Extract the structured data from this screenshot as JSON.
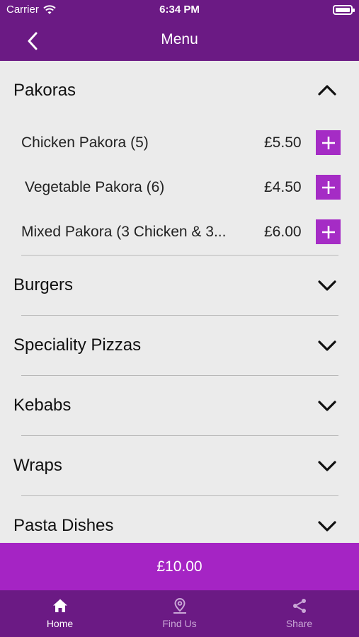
{
  "status": {
    "carrier": "Carrier",
    "time": "6:34 PM"
  },
  "header": {
    "title": "Menu"
  },
  "sections": [
    {
      "title": "Pakoras",
      "expanded": true,
      "items": [
        {
          "name": "Chicken Pakora (5)",
          "price": "£5.50"
        },
        {
          "name": "Vegetable Pakora (6)",
          "price": "£4.50"
        },
        {
          "name": "Mixed Pakora (3 Chicken & 3...",
          "price": "£6.00"
        }
      ]
    },
    {
      "title": "Burgers",
      "expanded": false
    },
    {
      "title": "Speciality Pizzas",
      "expanded": false
    },
    {
      "title": "Kebabs",
      "expanded": false
    },
    {
      "title": "Wraps",
      "expanded": false
    },
    {
      "title": "Pasta Dishes",
      "expanded": false
    }
  ],
  "cart": {
    "total": "£10.00"
  },
  "tabs": [
    {
      "label": "Home",
      "icon": "home-icon",
      "active": true
    },
    {
      "label": "Find Us",
      "icon": "location-pin-icon",
      "active": false
    },
    {
      "label": "Share",
      "icon": "share-icon",
      "active": false
    }
  ],
  "colors": {
    "header": "#6b1a84",
    "accent": "#a524c4",
    "background": "#ebebeb"
  }
}
